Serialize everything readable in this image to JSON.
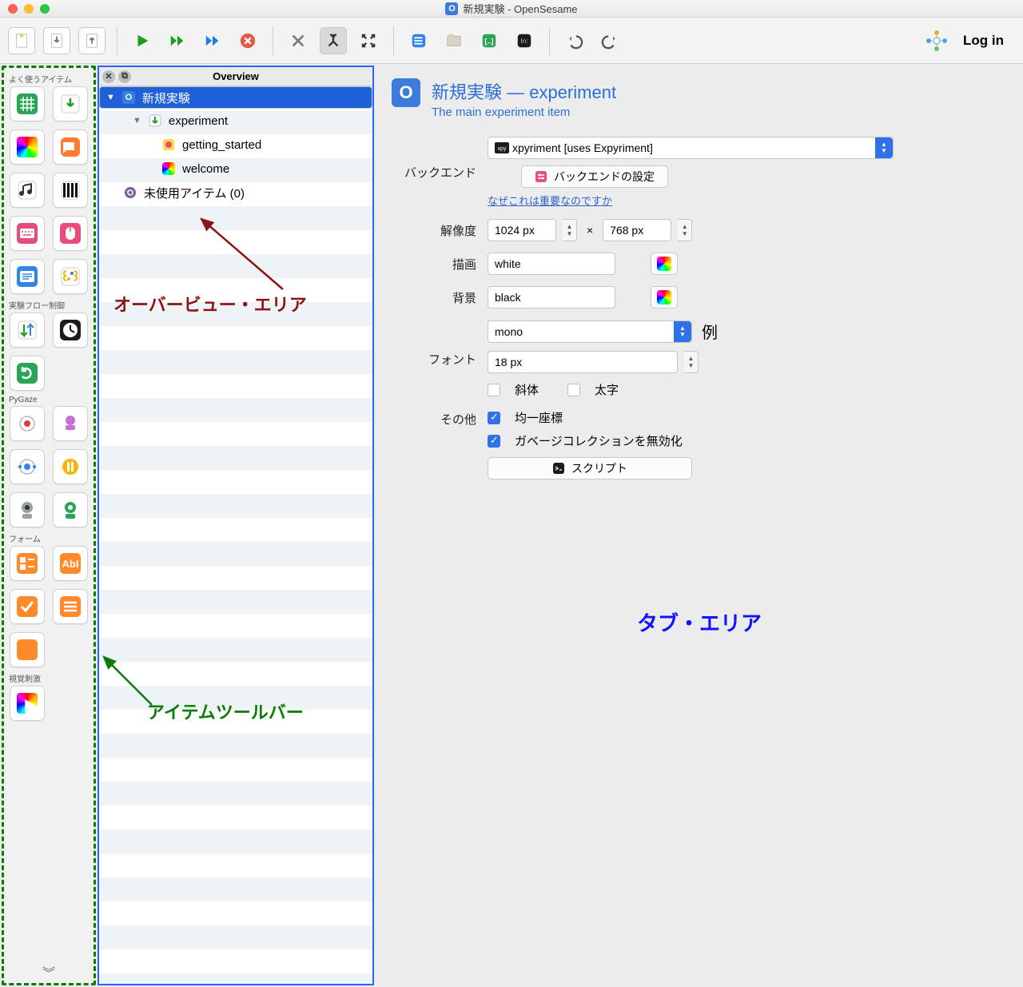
{
  "window": {
    "title": "新規実験 - OpenSesame"
  },
  "toolbar": {
    "login_label": "Log in"
  },
  "itembar": {
    "cat_frequent": "よく使うアイテム",
    "cat_flow": "実験フロー制御",
    "cat_pygaze": "PyGaze",
    "cat_form": "フォーム",
    "cat_visual": "視覚刺激"
  },
  "overview": {
    "title": "Overview",
    "root": "新規実験",
    "experiment": "experiment",
    "getting_started": "getting_started",
    "welcome": "welcome",
    "trash": "未使用アイテム (0)"
  },
  "annotations": {
    "overview_area": "オーバービュー・エリア",
    "item_toolbar": "アイテムツールバー",
    "tab_area": "タブ・エリア"
  },
  "editor": {
    "header_title": "新規実験 — experiment",
    "header_sub": "The main experiment item",
    "labels": {
      "backend": "バックエンド",
      "resolution": "解像度",
      "foreground": "描画",
      "background": "背景",
      "font": "フォント",
      "misc": "その他"
    },
    "backend": {
      "selected": "xpyriment [uses Expyriment]",
      "settings_btn": "バックエンドの設定",
      "why_link": "なぜこれは重要なのですか"
    },
    "resolution": {
      "w": "1024 px",
      "x": "×",
      "h": "768 px"
    },
    "foreground": "white",
    "background": "black",
    "font": {
      "family": "mono",
      "size": "18 px",
      "example": "例",
      "italic": "斜体",
      "bold": "太字"
    },
    "misc": {
      "uniform": "均一座標",
      "gc": "ガベージコレクションを無効化",
      "script_btn": "スクリプト"
    }
  }
}
